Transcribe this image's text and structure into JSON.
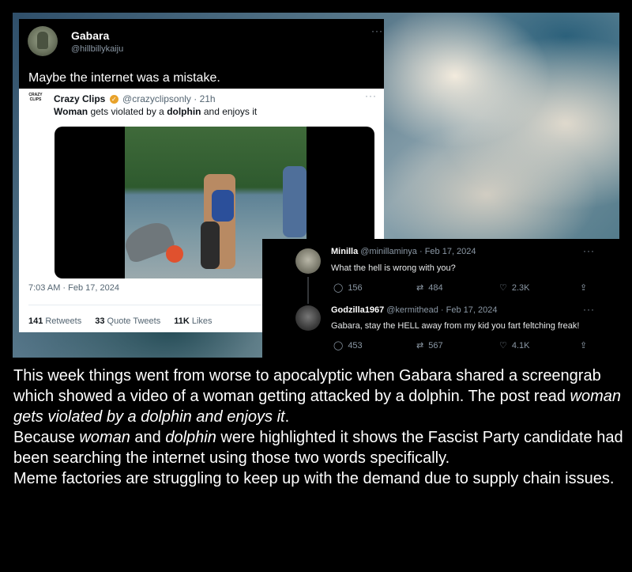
{
  "main_tweet": {
    "name": "Gabara",
    "handle": "@hillbillykaiju",
    "more": "···",
    "text": "Maybe the internet was a mistake."
  },
  "quoted_tweet": {
    "logo_text": "CRAZY CLIPS",
    "name": "Crazy Clips",
    "handle_time": "@crazyclipsonly · 21h",
    "text_parts": [
      "Woman",
      " gets violated by a ",
      "dolphin",
      " and enjoys it"
    ],
    "timestamp": "7:03 AM · Feb 17, 2024",
    "stats": {
      "retweets_count": "141",
      "retweets_label": "Retweets",
      "quotes_count": "33",
      "quotes_label": "Quote Tweets",
      "likes_count": "11K",
      "likes_label": "Likes"
    }
  },
  "replies": [
    {
      "name": "Minilla",
      "meta": "@minillaminya · Feb 17, 2024",
      "text": "What the hell is wrong with you?",
      "replies": "156",
      "retweets": "484",
      "likes": "2.3K"
    },
    {
      "name": "Godzilla1967",
      "meta": "@kermithead · Feb 17, 2024",
      "text": "Gabara, stay the HELL away from my kid you fart feltching freak!",
      "replies": "453",
      "retweets": "567",
      "likes": "4.1K"
    }
  ],
  "icons": {
    "reply": "reply-icon",
    "retweet": "retweet-icon",
    "like": "heart-icon",
    "share": "share-icon",
    "verified": "verified-badge-icon",
    "more": "more-dots-icon"
  },
  "caption": {
    "p1_a": "This week things went from worse to apocalyptic when Gabara shared a screengrab which showed a video of a woman getting attacked by a dolphin. The post read ",
    "p1_italic": "woman gets violated by a dolphin and enjoys it",
    "p1_b": ".",
    "p2_a": "Because ",
    "p2_i1": "woman",
    "p2_b": " and ",
    "p2_i2": "dolphin",
    "p2_c": " were highlighted it shows the Fascist Party candidate had been searching the internet using those two words specifically.",
    "p3": "Meme factories are struggling to keep up with the demand due to supply chain issues."
  },
  "colors": {
    "background": "#000000",
    "caption_text": "#ffffff",
    "muted_text": "#8b98a5",
    "verified_badge": "#e8a22a"
  }
}
